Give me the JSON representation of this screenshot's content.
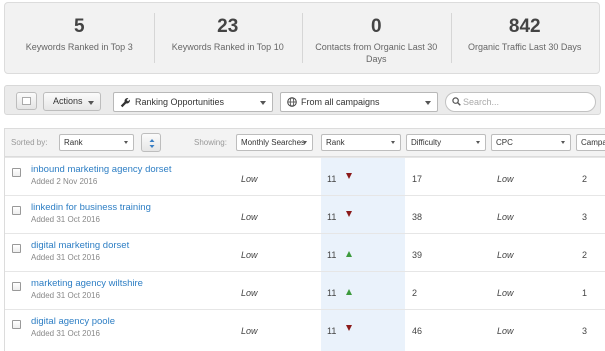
{
  "stats": [
    {
      "value": "5",
      "label": "Keywords Ranked in Top 3"
    },
    {
      "value": "23",
      "label": "Keywords Ranked in Top 10"
    },
    {
      "value": "0",
      "label": "Contacts from Organic Last 30 Days"
    },
    {
      "value": "842",
      "label": "Organic Traffic Last 30 Days"
    }
  ],
  "toolbar": {
    "actions_label": "Actions",
    "ranking_select": "Ranking Opportunities",
    "campaign_select": "From all campaigns",
    "search_placeholder": "Search..."
  },
  "table_header": {
    "sorted_by_label": "Sorted by:",
    "sort_select": "Rank",
    "showing_label": "Showing:",
    "columns": [
      "Monthly Searches",
      "Rank",
      "Difficulty",
      "CPC",
      "Campaign"
    ]
  },
  "rows": [
    {
      "keyword": "inbound marketing agency dorset",
      "added": "Added 2 Nov 2016",
      "monthly": "Low",
      "rank": "11",
      "trend": "down",
      "difficulty": "17",
      "cpc": "Low",
      "campaign": "2"
    },
    {
      "keyword": "linkedin for business training",
      "added": "Added 31 Oct 2016",
      "monthly": "Low",
      "rank": "11",
      "trend": "down",
      "difficulty": "38",
      "cpc": "Low",
      "campaign": "3"
    },
    {
      "keyword": "digital marketing dorset",
      "added": "Added 31 Oct 2016",
      "monthly": "Low",
      "rank": "11",
      "trend": "up",
      "difficulty": "39",
      "cpc": "Low",
      "campaign": "2"
    },
    {
      "keyword": "marketing agency wiltshire",
      "added": "Added 31 Oct 2016",
      "monthly": "Low",
      "rank": "11",
      "trend": "up",
      "difficulty": "2",
      "cpc": "Low",
      "campaign": "1"
    },
    {
      "keyword": "digital agency poole",
      "added": "Added 31 Oct 2016",
      "monthly": "Low",
      "rank": "11",
      "trend": "down",
      "difficulty": "46",
      "cpc": "Low",
      "campaign": "3"
    }
  ],
  "colors": {
    "link": "#2d7ec4",
    "trend_down": "#8b1a1a",
    "trend_up": "#3d9a3d",
    "rank_highlight": "#eaf2fb"
  }
}
